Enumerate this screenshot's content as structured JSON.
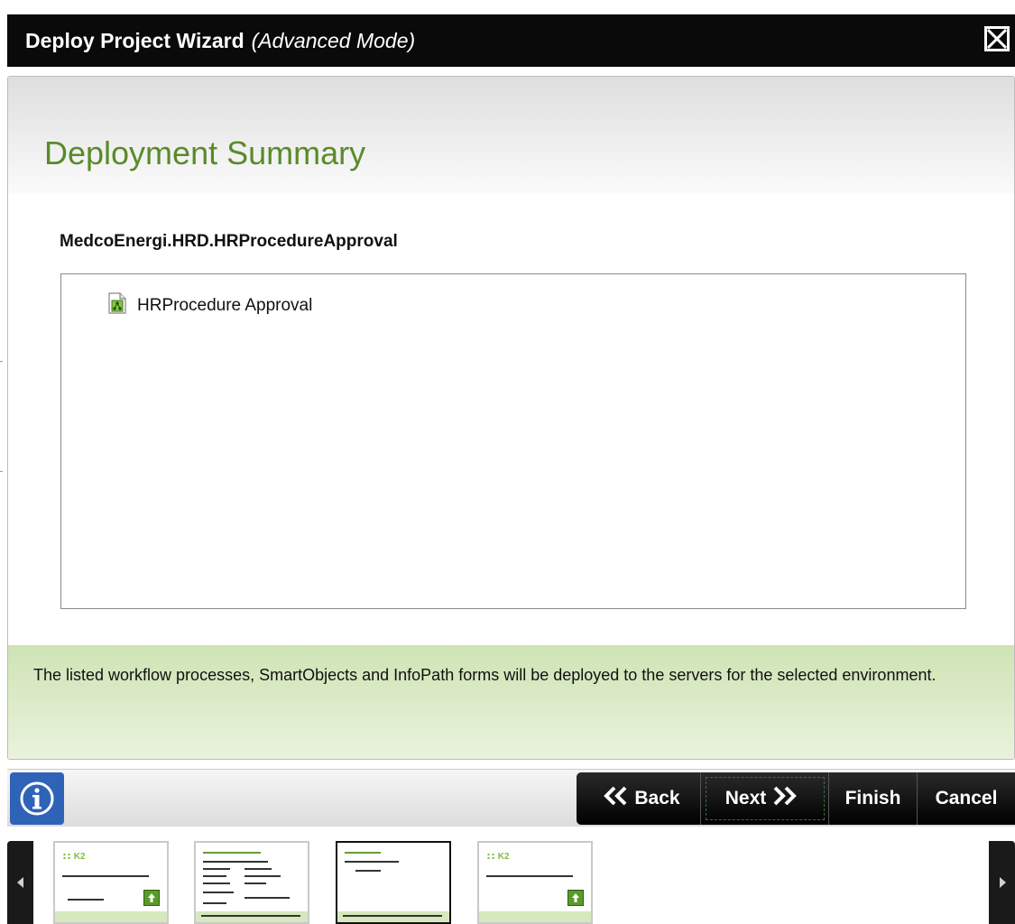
{
  "window": {
    "title": "Deploy Project Wizard",
    "mode": "(Advanced Mode)",
    "close_icon": "close-x-box-icon"
  },
  "page": {
    "heading": "Deployment Summary",
    "project_name": "MedcoEnergi.HRD.HRProcedureApproval",
    "items": [
      {
        "label": "HRProcedure Approval",
        "icon": "workflow-process-icon"
      }
    ],
    "info_text": "The listed workflow processes, SmartObjects and InfoPath forms will be deployed to the servers for the selected environment."
  },
  "buttons": {
    "help_icon": "info-icon",
    "back": "Back",
    "next": "Next",
    "finish": "Finish",
    "cancel": "Cancel"
  },
  "thumbnails": {
    "logo_text": "K2",
    "selected_index": 2,
    "count": 4
  },
  "colors": {
    "heading": "#5a8a2a",
    "titlebar": "#0a0a0a",
    "info_bar": "#d6e8be",
    "help_button": "#2f63b8"
  }
}
